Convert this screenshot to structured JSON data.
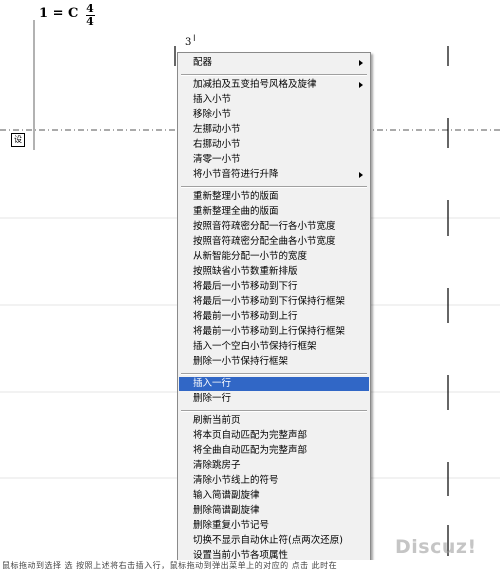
{
  "score": {
    "key_label": "1 = C",
    "time_sig_top": "4",
    "time_sig_bottom": "4",
    "measure_number": "3",
    "cursor_glyph": "I",
    "side_tag": "设"
  },
  "context_menu": {
    "items": [
      {
        "label": "配器",
        "submenu": true
      },
      {
        "label": "加减拍及五变拍号风格及旋律",
        "submenu": true
      },
      {
        "label": "插入小节",
        "submenu": false
      },
      {
        "label": "移除小节",
        "submenu": false
      },
      {
        "label": "左挪动小节",
        "submenu": false
      },
      {
        "label": "右挪动小节",
        "submenu": false
      },
      {
        "label": "清零一小节",
        "submenu": false
      },
      {
        "label": "将小节音符进行升降",
        "submenu": true
      },
      {
        "label": "重新整理小节的版面",
        "submenu": false
      },
      {
        "label": "重新整理全曲的版面",
        "submenu": false
      },
      {
        "label": "按照音符疏密分配一行各小节宽度",
        "submenu": false
      },
      {
        "label": "按照音符疏密分配全曲各小节宽度",
        "submenu": false
      },
      {
        "label": "从新智能分配一小节的宽度",
        "submenu": false
      },
      {
        "label": "按照缺省小节数重新排版",
        "submenu": false
      },
      {
        "label": "将最后一小节移动到下行",
        "submenu": false
      },
      {
        "label": "将最后一小节移动到下行保持行框架",
        "submenu": false
      },
      {
        "label": "将最前一小节移动到上行",
        "submenu": false
      },
      {
        "label": "将最前一小节移动到上行保持行框架",
        "submenu": false
      },
      {
        "label": "插入一个空白小节保持行框架",
        "submenu": false
      },
      {
        "label": "删除一小节保持行框架",
        "submenu": false
      },
      {
        "label": "插入一行",
        "submenu": false,
        "highlighted": true
      },
      {
        "label": "删除一行",
        "submenu": false
      },
      {
        "label": "刷新当前页",
        "submenu": false
      },
      {
        "label": "将本页自动匹配为完整声部",
        "submenu": false
      },
      {
        "label": "将全曲自动匹配为完整声部",
        "submenu": false
      },
      {
        "label": "清除跳房子",
        "submenu": false
      },
      {
        "label": "清除小节线上的符号",
        "submenu": false
      },
      {
        "label": "输入简谱副旋律",
        "submenu": false
      },
      {
        "label": "删除简谱副旋律",
        "submenu": false
      },
      {
        "label": "删除重复小节记号",
        "submenu": false
      },
      {
        "label": "切换不显示自动休止符(点两次还原)",
        "submenu": false
      },
      {
        "label": "设置当前小节各项属性",
        "submenu": false
      }
    ],
    "highlight_color": "#3167c6"
  },
  "bottom_caption": "鼠标拖动到选择 选 按照上述将右击插入行，鼠标拖动到弹出菜单上的对应的 点击 此时在",
  "watermark": "Discuz!"
}
